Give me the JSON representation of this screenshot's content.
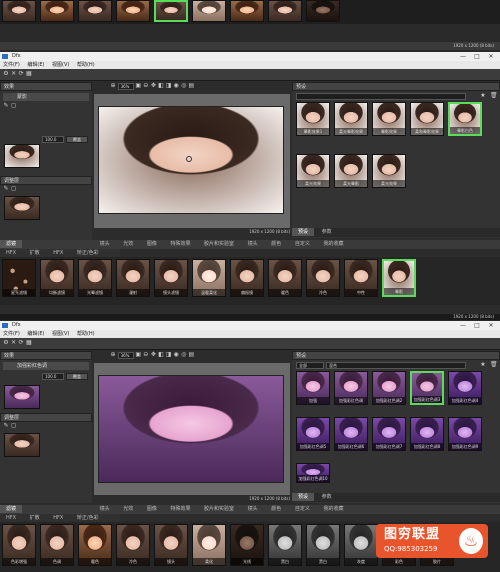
{
  "top_strip": {
    "captions": [
      "",
      "",
      "",
      "",
      "",
      "",
      "",
      ""
    ],
    "status": "1920 x 1200 (8 bits)"
  },
  "app": {
    "title": "Dfx",
    "menu": [
      "文件(F)",
      "编辑(E)",
      "视图(V)",
      "帮助(H)"
    ],
    "window_controls": [
      "—",
      "□",
      "✕"
    ]
  },
  "win1": {
    "left_panel": {
      "header": "效果",
      "layer_label": "蒙影",
      "opacity_value": "100.0",
      "blend_label": "覆盖",
      "mask_header": "遮罩",
      "section2_label": "调整层"
    },
    "zoom_value": "36%",
    "status": "1920 x 1200 (8 bits)",
    "right_panel": {
      "header": "预设",
      "presets": [
        {
          "caption": "晕影效果1"
        },
        {
          "caption": "柔光晕影效果"
        },
        {
          "caption": "晕影效果"
        },
        {
          "caption": "柔和晕影效果"
        },
        {
          "caption": "晕影白色",
          "selected": true
        },
        {
          "caption": "柔光效果"
        },
        {
          "caption": "柔光晕影"
        },
        {
          "caption": "柔光效果"
        }
      ],
      "tabs": [
        "预设",
        "参数"
      ]
    },
    "filter_bar": {
      "tabs": [
        "滤镜",
        "镜头",
        "光效",
        "图像",
        "特殊效果",
        "胶片和实验室",
        "镜头",
        "颜色",
        "自定义",
        "我的收藏"
      ],
      "subtabs": [
        "HFX",
        "扩散",
        "HFX",
        "矫正/色彩"
      ],
      "items": [
        {
          "caption": "星光滤镜"
        },
        {
          "caption": "均衡滤镜"
        },
        {
          "caption": "光晕滤镜"
        },
        {
          "caption": "漫射"
        },
        {
          "caption": "镜头滤镜"
        },
        {
          "caption": "温暖柔化"
        },
        {
          "caption": "偏振镜"
        },
        {
          "caption": "暖色"
        },
        {
          "caption": "冷色"
        },
        {
          "caption": "中性"
        },
        {
          "caption": "晕影",
          "selected": true
        }
      ]
    }
  },
  "win2": {
    "title": "Dfx",
    "menu": [
      "文件(F)",
      "编辑(E)",
      "视图(V)",
      "帮助(H)"
    ],
    "left_panel": {
      "header": "效果",
      "layer_label": "加强彩红色调",
      "opacity_value": "100.0",
      "blend_label": "覆盖",
      "section2_label": "调整层"
    },
    "zoom_value": "36%",
    "status": "1920 x 1200 (8 bits)",
    "right_panel": {
      "header": "预设",
      "dropdown": "全部",
      "dropdown2": "混合",
      "presets": [
        {
          "caption": "加强"
        },
        {
          "caption": "加强彩红色调"
        },
        {
          "caption": "加强彩红色调2"
        },
        {
          "caption": "加强彩红色调3",
          "selected": true
        },
        {
          "caption": "加强彩红色调4"
        },
        {
          "caption": "加强彩红色调5"
        },
        {
          "caption": "加强彩红色调6"
        },
        {
          "caption": "加强彩红色调7"
        },
        {
          "caption": "加强彩红色调8"
        },
        {
          "caption": "加强彩红色调9"
        },
        {
          "caption": "加强彩红色调10"
        }
      ],
      "tabs": [
        "预设",
        "参数"
      ]
    },
    "filter_bar": {
      "tabs": [
        "滤镜",
        "镜头",
        "光效",
        "图像",
        "特殊效果",
        "胶片和实验室",
        "镜头",
        "颜色",
        "自定义",
        "我的收藏"
      ],
      "subtabs": [
        "HFX",
        "扩散",
        "HFX",
        "矫正/色彩"
      ],
      "items": [
        {
          "caption": "色彩增强"
        },
        {
          "caption": "色调"
        },
        {
          "caption": "暖色"
        },
        {
          "caption": "冷色"
        },
        {
          "caption": "镜头"
        },
        {
          "caption": "柔化"
        },
        {
          "caption": "光线"
        },
        {
          "caption": "黑白"
        },
        {
          "caption": "黑白"
        },
        {
          "caption": "灰度"
        },
        {
          "caption": "彩色"
        },
        {
          "caption": "胶片"
        }
      ]
    }
  },
  "watermark": {
    "title": "图穷联盟",
    "qq": "QQ:985303259"
  },
  "colors": {
    "selected_border": "#5adc5a",
    "watermark_bg": "#e8542c"
  }
}
